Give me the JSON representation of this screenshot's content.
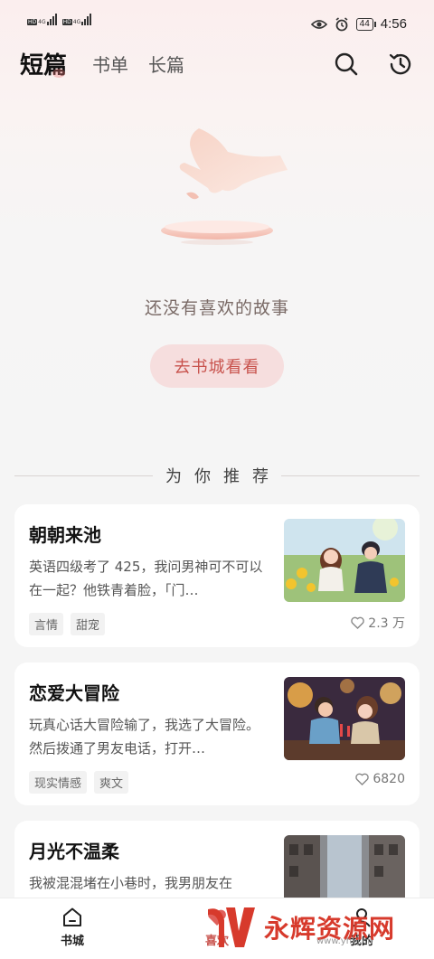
{
  "status_bar": {
    "time": "4:56",
    "battery": "44",
    "sim1": {
      "hd": "HD",
      "net": "4G"
    },
    "sim2": {
      "hd": "HD",
      "net": "4G"
    }
  },
  "header": {
    "tabs": [
      {
        "label": "短篇",
        "active": true
      },
      {
        "label": "书单",
        "active": false
      },
      {
        "label": "长篇",
        "active": false
      }
    ],
    "icons": [
      "search-icon",
      "history-icon"
    ]
  },
  "empty_state": {
    "message": "还没有喜欢的故事",
    "button_label": "去书城看看"
  },
  "recommend": {
    "title": "为你推荐",
    "cards": [
      {
        "title": "朝朝来池",
        "description": "英语四级考了 425，我问男神可不可以在一起？他铁青着脸，「门…",
        "tags": [
          "言情",
          "甜宠"
        ],
        "likes": "2.3 万"
      },
      {
        "title": "恋爱大冒险",
        "description": "玩真心话大冒险输了，我选了大冒险。然后拨通了男友电话，打开…",
        "tags": [
          "现实情感",
          "爽文"
        ],
        "likes": "6820"
      },
      {
        "title": "月光不温柔",
        "description": "我被混混堵在小巷时，我男朋友在",
        "tags": [],
        "likes": ""
      }
    ]
  },
  "bottom_nav": {
    "items": [
      {
        "label": "书城"
      },
      {
        "label": "喜欢"
      },
      {
        "label": "我的"
      }
    ]
  },
  "watermark": {
    "text": "永辉资源网",
    "url": "www.yhkj.cn"
  },
  "colors": {
    "accent": "#c8534d",
    "button_bg": "#f6dede",
    "watermark": "#d73a2c"
  }
}
